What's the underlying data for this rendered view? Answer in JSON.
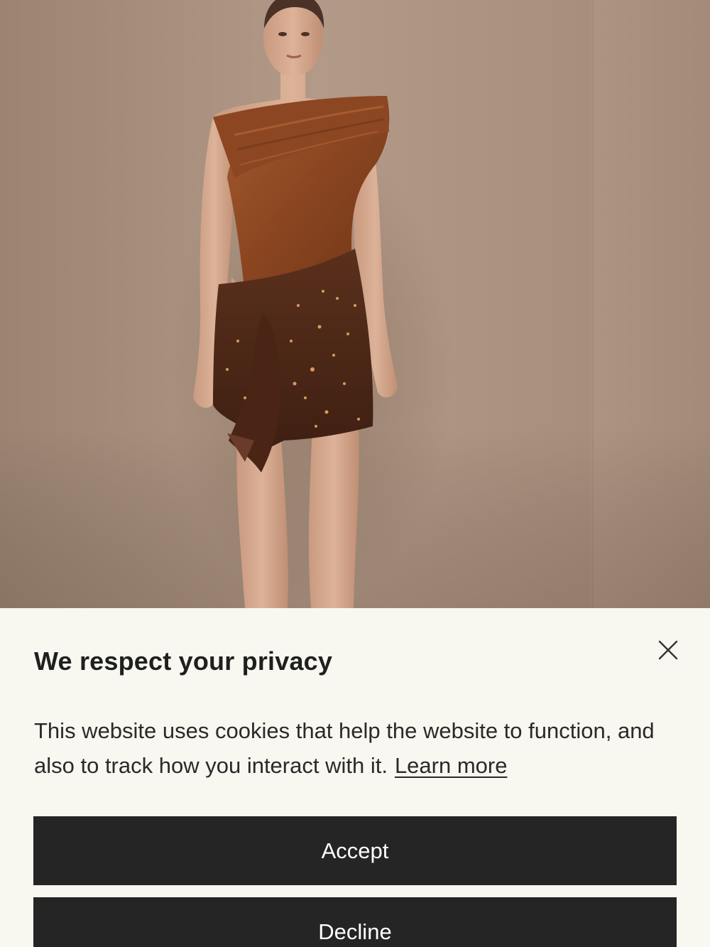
{
  "consent": {
    "title": "We respect your privacy",
    "body_text": "This website uses cookies that help the website to function, and also to track how you interact with it.",
    "learn_more_label": "Learn more",
    "accept_label": "Accept",
    "decline_label": "Decline",
    "close_icon": "close-icon"
  },
  "hero": {
    "image_subject": "model-wearing-brown-one-shoulder-sequin-mini-dress"
  },
  "colors": {
    "panel_background": "#f8f7f0",
    "button_background": "#252525",
    "button_text": "#ffffff",
    "backdrop": "#a78d7b"
  }
}
